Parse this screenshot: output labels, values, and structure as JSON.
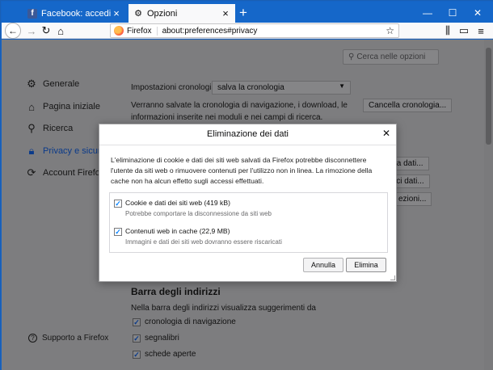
{
  "tabs": [
    {
      "label": "Facebook: accedi o iscriviti",
      "icon": "facebook-icon"
    },
    {
      "label": "Opzioni",
      "icon": "gear-icon"
    }
  ],
  "window_controls": {
    "minimize": "—",
    "maximize": "☐",
    "close": "✕"
  },
  "navbar": {
    "identity": "Firefox",
    "url": "about:preferences#privacy"
  },
  "search": {
    "placeholder": "Cerca nelle opzioni"
  },
  "sidebar": {
    "items": [
      {
        "label": "Generale",
        "icon": "gear-icon"
      },
      {
        "label": "Pagina iniziale",
        "icon": "home-icon"
      },
      {
        "label": "Ricerca",
        "icon": "search-icon"
      },
      {
        "label": "Privacy e sicurezza",
        "icon": "lock-icon"
      },
      {
        "label": "Account Firefox",
        "icon": "sync-icon"
      }
    ],
    "support": "Supporto a Firefox"
  },
  "history": {
    "label": "Impostazioni cronologia:",
    "select_value": "salva la cronologia",
    "desc_line1": "Verranno salvate la cronologia di navigazione, i download, le",
    "desc_line2": "informazioni inserite nei moduli e nei campi di ricerca.",
    "clear_button": "Cancella cronologia..."
  },
  "partial_buttons": [
    "ina dati...",
    "isci dati...",
    "ezioni..."
  ],
  "address_bar_section": {
    "title": "Barra degli indirizzi",
    "desc": "Nella barra degli indirizzi visualizza suggerimenti da",
    "options": [
      {
        "label": "cronologia di navigazione",
        "checked": true
      },
      {
        "label": "segnalibri",
        "checked": true
      },
      {
        "label": "schede aperte",
        "checked": true
      }
    ]
  },
  "dialog": {
    "title": "Eliminazione dei dati",
    "body": "L'eliminazione di cookie e dati dei siti web salvati da Firefox potrebbe disconnettere l'utente da siti web o rimuovere contenuti per l'utilizzo non in linea. La rimozione della cache non ha alcun effetto sugli accessi effettuati.",
    "options": [
      {
        "label": "Cookie e dati dei siti web (419 kB)",
        "sub": "Potrebbe comportare la disconnessione da siti web",
        "checked": true
      },
      {
        "label": "Contenuti web in cache (22,9 MB)",
        "sub": "Immagini e dati dei siti web dovranno essere riscaricati",
        "checked": true
      }
    ],
    "cancel": "Annulla",
    "confirm": "Elimina"
  }
}
